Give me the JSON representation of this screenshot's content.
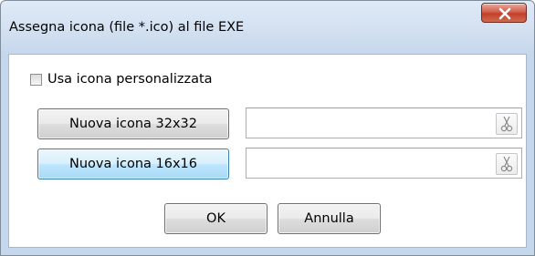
{
  "dialog": {
    "title": "Assegna icona (file *.ico) al file EXE"
  },
  "custom_icon": {
    "label": "Usa icona personalizzata",
    "checked": false
  },
  "icon32": {
    "button_label": "Nuova icona 32x32",
    "value": ""
  },
  "icon16": {
    "button_label": "Nuova icona 16x16",
    "value": ""
  },
  "footer": {
    "ok_label": "OK",
    "cancel_label": "Annulla"
  },
  "icons": {
    "close": "close-icon",
    "clear": "scissors-icon"
  }
}
